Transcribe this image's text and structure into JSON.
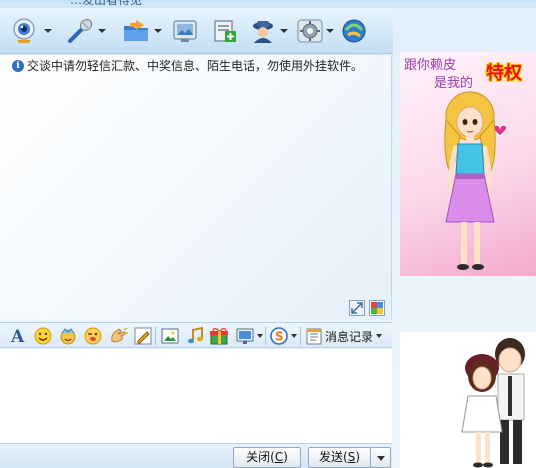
{
  "window": {
    "title": "…发出看得见"
  },
  "toolbar": {
    "icons": [
      "video-camera-icon",
      "microphone-icon",
      "folder-send-icon",
      "screen-capture-icon",
      "add-app-icon",
      "group-chat-icon",
      "settings-icon",
      "firewall-icon"
    ]
  },
  "chat": {
    "notice_text": "交谈中请勿轻信汇款、中奖信息、陌生电话，勿使用外挂软件。"
  },
  "input_toolbar": {
    "history_label": "消息记录"
  },
  "buttons": {
    "close_label": "关闭",
    "close_key": "C",
    "send_label": "发送",
    "send_key": "S"
  },
  "ads": {
    "top_line1": "跟你赖皮",
    "top_line2": "是我的",
    "badge": "特权"
  },
  "colors": {
    "accent": "#2f6fc0",
    "badge_red": "#e8111a",
    "ad_pink": "#f3a9cf"
  }
}
